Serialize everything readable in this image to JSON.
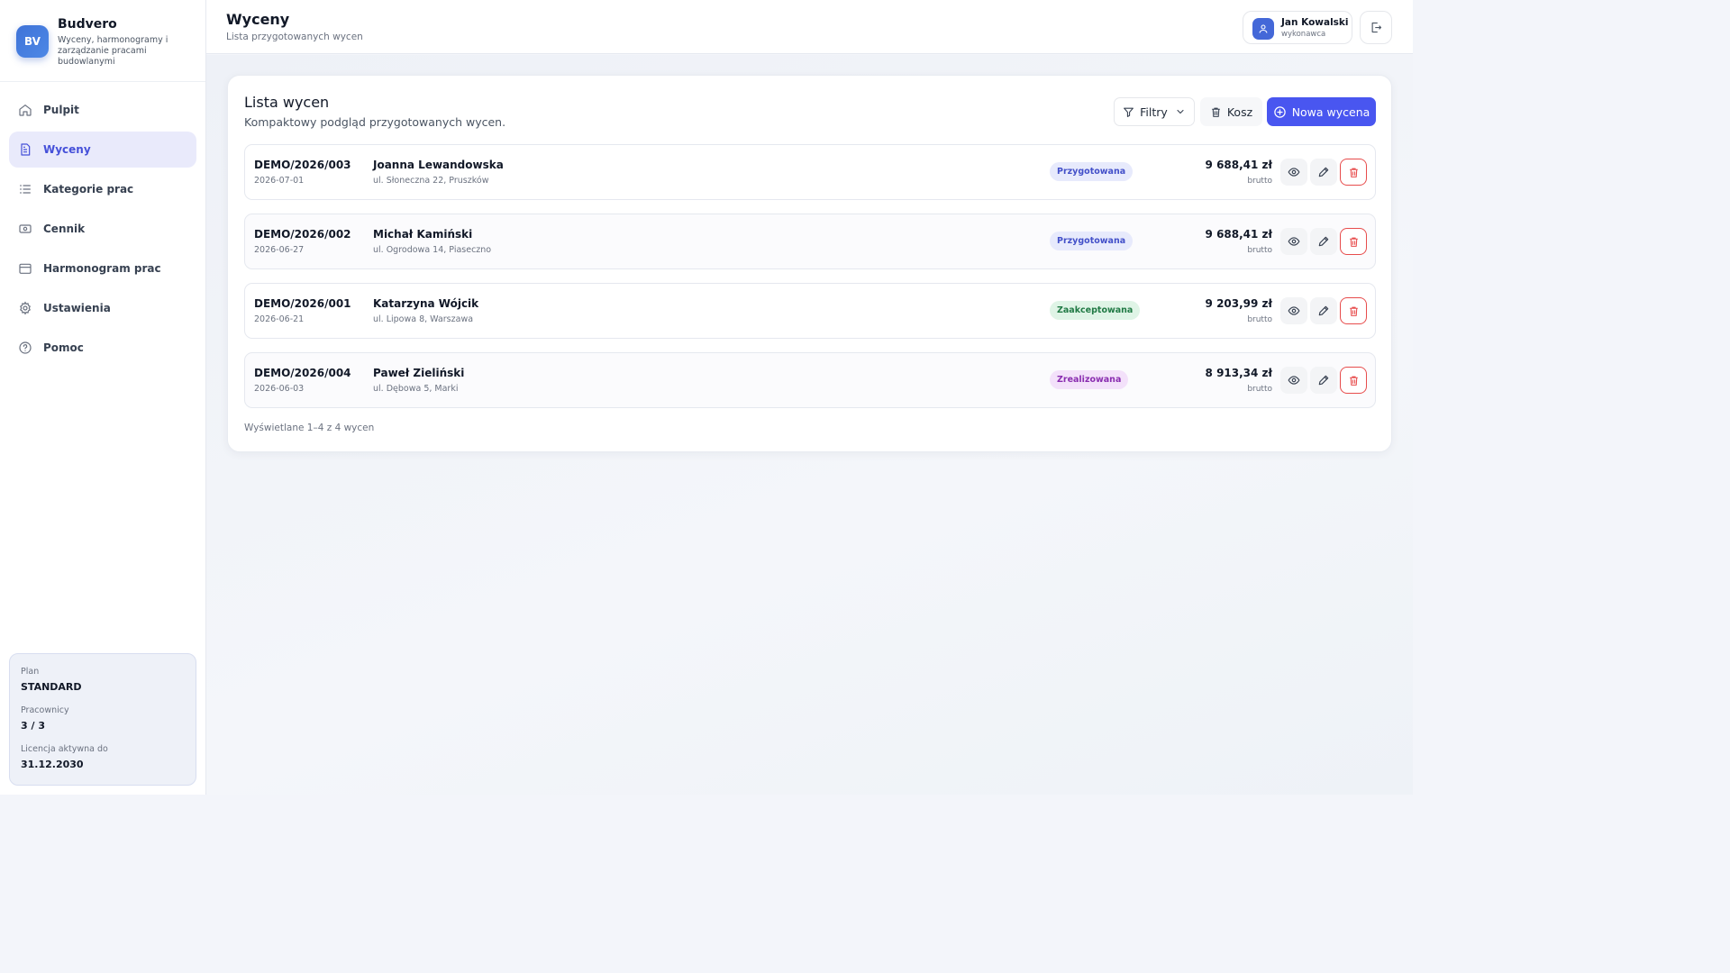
{
  "brand": {
    "logo": "BV",
    "name": "Budvero",
    "tagline": "Wyceny, harmonogramy i zarządzanie pracami budowlanymi"
  },
  "nav": [
    {
      "label": "Pulpit",
      "icon": "home-icon",
      "active": false
    },
    {
      "label": "Wyceny",
      "icon": "document-icon",
      "active": true
    },
    {
      "label": "Kategorie prac",
      "icon": "list-icon",
      "active": false
    },
    {
      "label": "Cennik",
      "icon": "money-icon",
      "active": false
    },
    {
      "label": "Harmonogram prac",
      "icon": "calendar-icon",
      "active": false
    },
    {
      "label": "Ustawienia",
      "icon": "gear-icon",
      "active": false
    },
    {
      "label": "Pomoc",
      "icon": "help-icon",
      "active": false
    }
  ],
  "plan": {
    "plan_label": "Plan",
    "plan_value": "STANDARD",
    "workers_label": "Pracownicy",
    "workers_value": "3 / 3",
    "license_label": "Licencja aktywna do",
    "license_value": "31.12.2030"
  },
  "header": {
    "title": "Wyceny",
    "subtitle": "Lista przygotowanych wycen",
    "user_name": "Jan Kowalski",
    "user_role": "wykonawca"
  },
  "card": {
    "title": "Lista wycen",
    "subtitle": "Kompaktowy podgląd przygotowanych wycen.",
    "filter_label": "Filtry",
    "trash_label": "Kosz",
    "new_label": "Nowa wycena",
    "footer": "Wyświetlane 1–4 z 4 wycen"
  },
  "quotes": [
    {
      "number": "DEMO/2026/003",
      "date": "2026-07-01",
      "client": "Joanna Lewandowska",
      "address": "ul. Słoneczna 22, Pruszków",
      "status": "Przygotowana",
      "status_kind": "prep",
      "amount": "9 688,41 zł",
      "amount_note": "brutto"
    },
    {
      "number": "DEMO/2026/002",
      "date": "2026-06-27",
      "client": "Michał Kamiński",
      "address": "ul. Ogrodowa 14, Piaseczno",
      "status": "Przygotowana",
      "status_kind": "prep",
      "amount": "9 688,41 zł",
      "amount_note": "brutto"
    },
    {
      "number": "DEMO/2026/001",
      "date": "2026-06-21",
      "client": "Katarzyna Wójcik",
      "address": "ul. Lipowa 8, Warszawa",
      "status": "Zaakceptowana",
      "status_kind": "acc",
      "amount": "9 203,99 zł",
      "amount_note": "brutto"
    },
    {
      "number": "DEMO/2026/004",
      "date": "2026-06-03",
      "client": "Paweł Zieliński",
      "address": "ul. Dębowa 5, Marki",
      "status": "Zrealizowana",
      "status_kind": "done",
      "amount": "8 913,34 zł",
      "amount_note": "brutto"
    }
  ],
  "colors": {
    "accent": "#4956f0",
    "active_nav_bg": "#e9eafb",
    "danger": "#e74c4c"
  }
}
